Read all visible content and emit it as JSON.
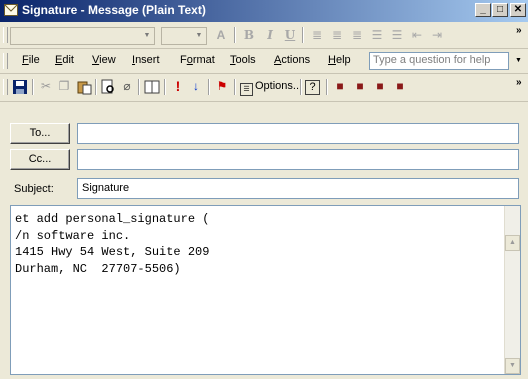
{
  "window": {
    "title": "Signature - Message (Plain Text)",
    "minimize_glyph": "_",
    "maximize_glyph": "□",
    "close_glyph": "✕"
  },
  "format_toolbar": {
    "font_combo_value": "",
    "size_combo_value": "",
    "icons": [
      "font-color",
      "bold",
      "italic",
      "underline",
      "align-left",
      "align-center",
      "align-right",
      "bullets",
      "numbering",
      "decrease-indent",
      "increase-indent"
    ]
  },
  "menu": {
    "items": [
      {
        "label": "File",
        "accel": "F",
        "rest": "ile"
      },
      {
        "label": "Edit",
        "accel": "E",
        "rest": "dit"
      },
      {
        "label": "View",
        "accel": "V",
        "rest": "iew"
      },
      {
        "label": "Insert",
        "accel": "I",
        "rest": "nsert"
      },
      {
        "label": "Format",
        "accel": "o",
        "pre": "F",
        "rest": "rmat"
      },
      {
        "label": "Tools",
        "accel": "T",
        "rest": "ools"
      },
      {
        "label": "Actions",
        "accel": "A",
        "rest": "ctions"
      },
      {
        "label": "Help",
        "accel": "H",
        "rest": "elp"
      }
    ],
    "help_placeholder": "Type a question for help"
  },
  "standard_toolbar": {
    "icons": [
      "save",
      "cut",
      "copy",
      "paste",
      "print-preview",
      "attach",
      "address-book",
      "importance-high",
      "importance-low",
      "flag",
      "options",
      "help",
      "previous",
      "next",
      "forward",
      "reply"
    ],
    "options_label": "Options..."
  },
  "header": {
    "to_button": "To...",
    "to_value": "",
    "cc_button": "Cc...",
    "cc_value": "",
    "subject_label": "Subject:",
    "subject_value": "Signature"
  },
  "body": {
    "text": "et add personal_signature (\n/n software inc.\n1415 Hwy 54 West, Suite 209\nDurham, NC  27707-5506)"
  },
  "colors": {
    "title_gradient_start": "#0a246a",
    "title_gradient_end": "#a6caf0",
    "chrome": "#ece9d8",
    "field_border": "#7f9db9",
    "importance_high": "#cc0000",
    "importance_low": "#0033cc"
  }
}
